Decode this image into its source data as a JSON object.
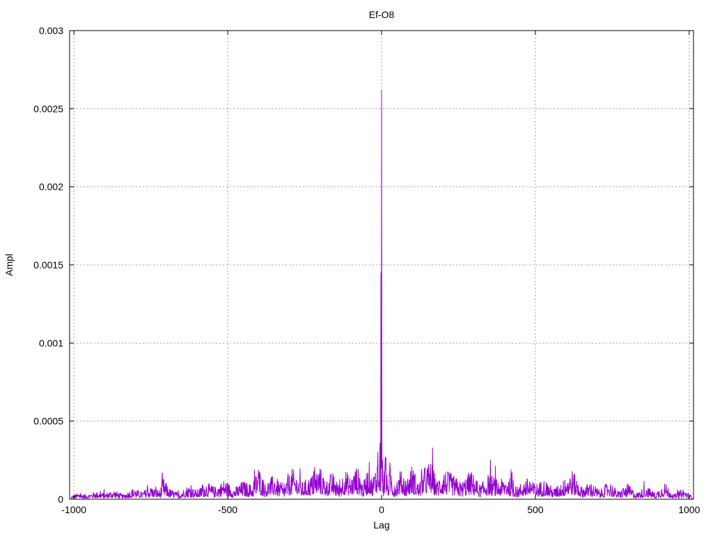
{
  "chart_data": {
    "type": "line",
    "title": "Ef-O8",
    "xlabel": "Lag",
    "ylabel": "Ampl",
    "xlim": [
      -1014,
      1014
    ],
    "ylim": [
      0,
      0.003
    ],
    "grid": true,
    "series_color": "#9400d3",
    "xticks": [
      {
        "value": -1000,
        "label": "-1000"
      },
      {
        "value": -500,
        "label": "-500"
      },
      {
        "value": 0,
        "label": "0"
      },
      {
        "value": 500,
        "label": "500"
      },
      {
        "value": 1000,
        "label": "1000"
      }
    ],
    "yticks": [
      {
        "value": 0,
        "label": "0"
      },
      {
        "value": 0.0005,
        "label": "0.0005"
      },
      {
        "value": 0.001,
        "label": "0.001"
      },
      {
        "value": 0.0015,
        "label": "0.0015"
      },
      {
        "value": 0.002,
        "label": "0.002"
      },
      {
        "value": 0.0025,
        "label": "0.0025"
      },
      {
        "value": 0.003,
        "label": "0.003"
      }
    ],
    "series": [
      {
        "x": [
          -1010,
          -985,
          -960,
          -930,
          -900,
          -870,
          -840,
          -810,
          -780,
          -750,
          -720,
          -710,
          -690,
          -660,
          -630,
          -600,
          -570,
          -540,
          -510,
          -480,
          -450,
          -420,
          -400,
          -380,
          -350,
          -320,
          -290,
          -260,
          -230,
          -200,
          -180,
          -160,
          -140,
          -120,
          -100,
          -80,
          -60,
          -40,
          -30,
          -20,
          -12,
          -8,
          -5,
          -3,
          -2,
          -1,
          0,
          1,
          2,
          3,
          5,
          8,
          12,
          20,
          30,
          40,
          60,
          80,
          100,
          120,
          140,
          160,
          180,
          200,
          230,
          260,
          290,
          320,
          350,
          380,
          410,
          440,
          470,
          500,
          530,
          560,
          590,
          620,
          650,
          680,
          710,
          740,
          770,
          800,
          830,
          860,
          890,
          920,
          950,
          980,
          1010
        ],
        "y": [
          2e-05,
          4e-05,
          3e-05,
          5e-05,
          4e-05,
          6e-05,
          3e-05,
          7e-05,
          5e-05,
          8e-05,
          6e-05,
          0.00014,
          7e-05,
          4e-05,
          9e-05,
          6e-05,
          0.00011,
          8e-05,
          0.00013,
          7e-05,
          0.00012,
          9e-05,
          0.00022,
          0.0001,
          0.00016,
          8e-05,
          0.0002,
          0.00011,
          0.00015,
          0.00021,
          0.00012,
          0.00018,
          9e-05,
          0.0002,
          0.00014,
          0.00022,
          0.0001,
          0.00024,
          0.00013,
          0.00021,
          0.0003,
          0.00012,
          0.00036,
          8e-05,
          0.00145,
          0.0002,
          0.00262,
          0.00034,
          0.00011,
          0.00025,
          8e-05,
          0.00018,
          0.00027,
          0.00012,
          0.00022,
          9e-05,
          0.00019,
          0.00013,
          0.00023,
          0.0001,
          0.00021,
          0.00025,
          0.00012,
          0.0002,
          0.00016,
          0.00011,
          0.00019,
          9e-05,
          0.00017,
          0.00012,
          0.00015,
          8e-05,
          0.00014,
          0.0001,
          0.00013,
          7e-05,
          0.00012,
          0.00019,
          8e-05,
          0.00011,
          6e-05,
          0.00012,
          5e-05,
          0.0001,
          4e-05,
          9e-05,
          4e-05,
          0.00011,
          3e-05,
          7e-05,
          2e-05
        ]
      }
    ]
  }
}
